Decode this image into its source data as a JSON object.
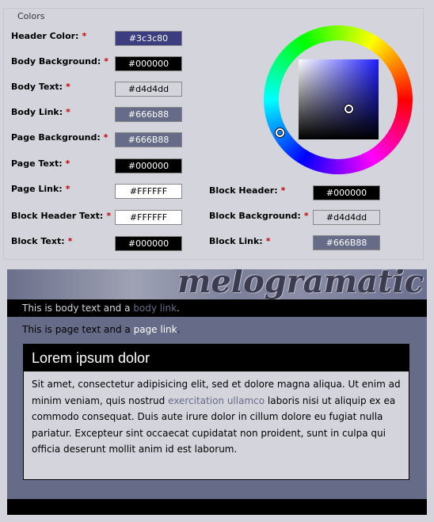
{
  "legend": "Colors",
  "fields": [
    {
      "id": "header-color",
      "label": "Header Color:",
      "value": "#3c3c80",
      "bg": "#3c3c80",
      "fg": "#ffffff"
    },
    {
      "id": "body-background",
      "label": "Body Background:",
      "value": "#000000",
      "bg": "#000000",
      "fg": "#ffffff"
    },
    {
      "id": "body-text",
      "label": "Body Text:",
      "value": "#d4d4dd",
      "bg": "#d4d4dd",
      "fg": "#000000"
    },
    {
      "id": "body-link",
      "label": "Body Link:",
      "value": "#666b88",
      "bg": "#666b88",
      "fg": "#ffffff"
    },
    {
      "id": "page-background",
      "label": "Page Background:",
      "value": "#666B88",
      "bg": "#666b88",
      "fg": "#ffffff"
    },
    {
      "id": "page-text",
      "label": "Page Text:",
      "value": "#000000",
      "bg": "#000000",
      "fg": "#ffffff"
    },
    {
      "id": "page-link",
      "label": "Page Link:",
      "value": "#FFFFFF",
      "bg": "#ffffff",
      "fg": "#000000"
    },
    {
      "id": "block-header-text",
      "label": "Block Header Text:",
      "value": "#FFFFFF",
      "bg": "#ffffff",
      "fg": "#000000"
    },
    {
      "id": "block-text",
      "label": "Block Text:",
      "value": "#000000",
      "bg": "#000000",
      "fg": "#ffffff"
    },
    {
      "id": "block-header",
      "label": "Block Header:",
      "value": "#000000",
      "bg": "#000000",
      "fg": "#ffffff"
    },
    {
      "id": "block-background",
      "label": "Block Background:",
      "value": "#d4d4dd",
      "bg": "#d4d4dd",
      "fg": "#000000"
    },
    {
      "id": "block-link",
      "label": "Block Link:",
      "value": "#666B88",
      "bg": "#666b88",
      "fg": "#ffffff"
    }
  ],
  "required_mark": "*",
  "preview": {
    "logo": "melogramatic",
    "body_text": "This is body text and a",
    "body_link": "body link",
    "page_text": "This is page text and a",
    "page_link": "page link",
    "period": ".",
    "block_title": "Lorem ipsum dolor",
    "block_text_1": "Sit amet, consectetur adipisicing elit, sed et dolore magna aliqua. Ut enim ad minim veniam, quis nostrud",
    "block_link": "exercitation ullamco",
    "block_text_2": "laboris nisi ut aliquip ex ea commodo consequat. Duis aute irure dolor in cillum dolore eu fugiat nulla pariatur. Excepteur sint occaecat cupidatat non proident, sunt in culpa qui officia deserunt mollit anim id est laborum."
  }
}
